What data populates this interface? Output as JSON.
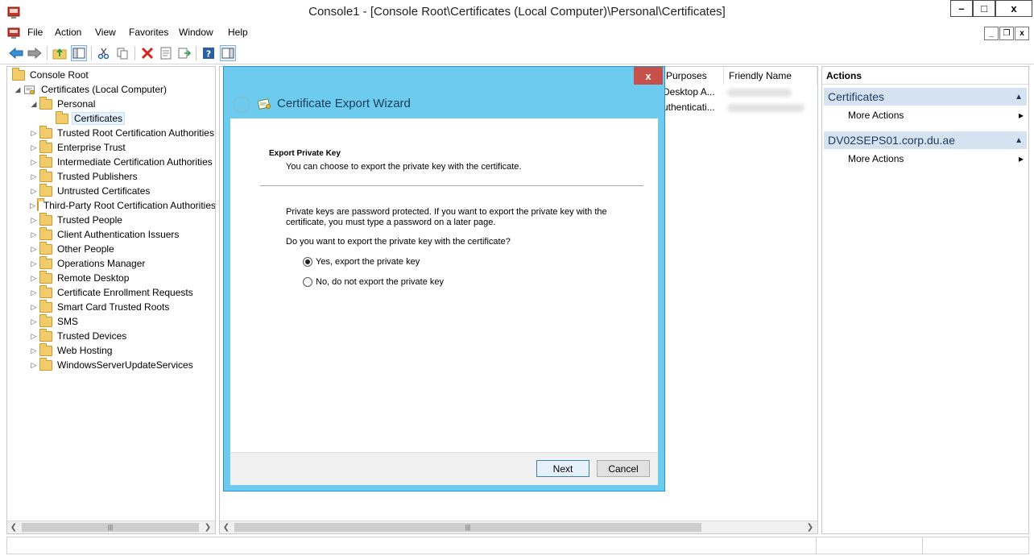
{
  "window": {
    "title": "Console1 - [Console Root\\Certificates (Local Computer)\\Personal\\Certificates]",
    "min_glyph": "–",
    "max_glyph": "□",
    "close_glyph": "x"
  },
  "menu": [
    "File",
    "Action",
    "View",
    "Favorites",
    "Window",
    "Help"
  ],
  "toolbar": {
    "icons": [
      "back-arrow-icon",
      "forward-arrow-icon",
      "up-folder-icon",
      "show-hide-tree-icon",
      "cut-icon",
      "copy-icon",
      "delete-icon",
      "properties-icon",
      "export-list-icon",
      "help-icon",
      "show-action-pane-icon"
    ]
  },
  "tree": {
    "root": "Console Root",
    "computer": "Certificates (Local Computer)",
    "personal": "Personal",
    "certificates": "Certificates",
    "stores": [
      "Trusted Root Certification Authorities",
      "Enterprise Trust",
      "Intermediate Certification Authorities",
      "Trusted Publishers",
      "Untrusted Certificates",
      "Third-Party Root Certification Authorities",
      "Trusted People",
      "Client Authentication Issuers",
      "Other People",
      "Operations Manager",
      "Remote Desktop",
      "Certificate Enrollment Requests",
      "Smart Card Trusted Roots",
      "SMS",
      "Trusted Devices",
      "Web Hosting",
      "WindowsServerUpdateServices"
    ]
  },
  "list": {
    "columns": [
      "Purposes",
      "Friendly Name"
    ],
    "rows": [
      {
        "purposes": "Desktop A..."
      },
      {
        "purposes": "uthenticati..."
      }
    ]
  },
  "actions": {
    "header": "Actions",
    "sections": [
      {
        "title": "Certificates",
        "item": "More Actions"
      },
      {
        "title": "DV02SEPS01.corp.du.ae",
        "item": "More Actions"
      }
    ]
  },
  "dialog": {
    "title": "Certificate Export Wizard",
    "close": "x",
    "heading": "Export Private Key",
    "subheading": "You can choose to export the private key with the certificate.",
    "para1_line1": "Private keys are password protected. If you want to export the private key with the",
    "para1_line2": "certificate, you must type a password on a later page.",
    "question": "Do you want to export the private key with the certificate?",
    "option_yes": "Yes, export the private key",
    "option_no": "No, do not export the private key",
    "selected": "yes",
    "next": "Next",
    "cancel": "Cancel"
  },
  "colors": {
    "dialog_frame": "#6ccbee",
    "close_button": "#c7504b",
    "action_section": "#d5e3f1",
    "folder": "#f2cc6a"
  }
}
